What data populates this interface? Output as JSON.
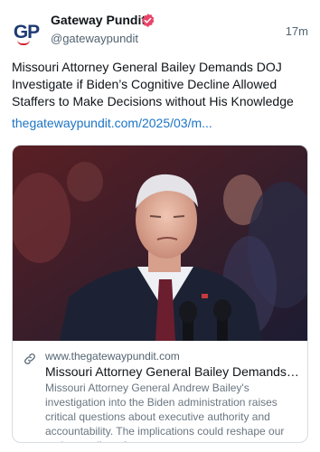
{
  "post": {
    "author": {
      "display_name": "Gateway Pundit",
      "handle": "@gatewaypundit",
      "avatar_text": "GP",
      "verified": true
    },
    "timestamp": "17m",
    "text": "Missouri Attorney General Bailey Demands DOJ Investigate if Biden’s Cognitive Decline Allowed Staffers to Make Decisions without His Knowledge",
    "link": "thegatewaypundit.com/2025/03/m..."
  },
  "card": {
    "domain": "www.thegatewaypundit.com",
    "title": "Missouri Attorney General Bailey Demands DOJ Investigate if Biden’s Cognitive Decline Allowed Staffers to Make Decisions without His Knowledge",
    "description": "Missouri Attorney General Andrew Bailey's investigation into the Biden administration raises critical questions about executive authority and accountability. The implications could reshape our understanding of cons..."
  },
  "colors": {
    "brand_blue": "#1f3b73",
    "brand_red": "#d5232f",
    "link": "#1d74c4",
    "verified_badge": "#e8456b",
    "muted_text": "#536471"
  }
}
